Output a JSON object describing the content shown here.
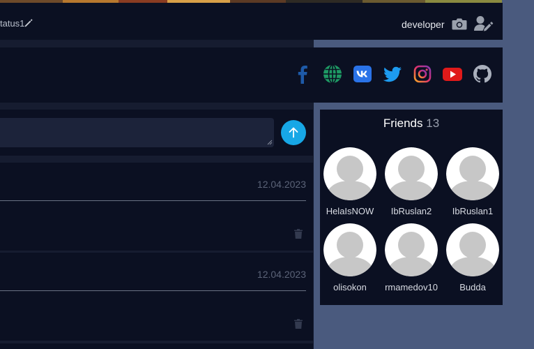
{
  "profile": {
    "status_text": "tatus1",
    "username": "developer"
  },
  "social": {
    "links": [
      {
        "name": "facebook-icon",
        "color": "#1e5aa8"
      },
      {
        "name": "website-globe-icon",
        "color": "#1e9a64"
      },
      {
        "name": "vk-icon",
        "color": "#2a73e8"
      },
      {
        "name": "twitter-icon",
        "color": "#1d9bf0"
      },
      {
        "name": "instagram-icon",
        "color": "#d62976"
      },
      {
        "name": "youtube-icon",
        "color": "#e01a1a"
      },
      {
        "name": "github-icon",
        "color": "#aab0bd"
      }
    ]
  },
  "composer": {
    "textarea_value": "",
    "send_button_color": "#17a7e6"
  },
  "posts": [
    {
      "date": "12.04.2023"
    },
    {
      "date": "12.04.2023"
    }
  ],
  "friends": {
    "title": "Friends",
    "count": "13",
    "list": [
      {
        "name": "HelaIsNOW"
      },
      {
        "name": "IbRuslan2"
      },
      {
        "name": "IbRuslan1"
      },
      {
        "name": "olisokon"
      },
      {
        "name": "rmamedov10"
      },
      {
        "name": "Budda"
      }
    ]
  }
}
